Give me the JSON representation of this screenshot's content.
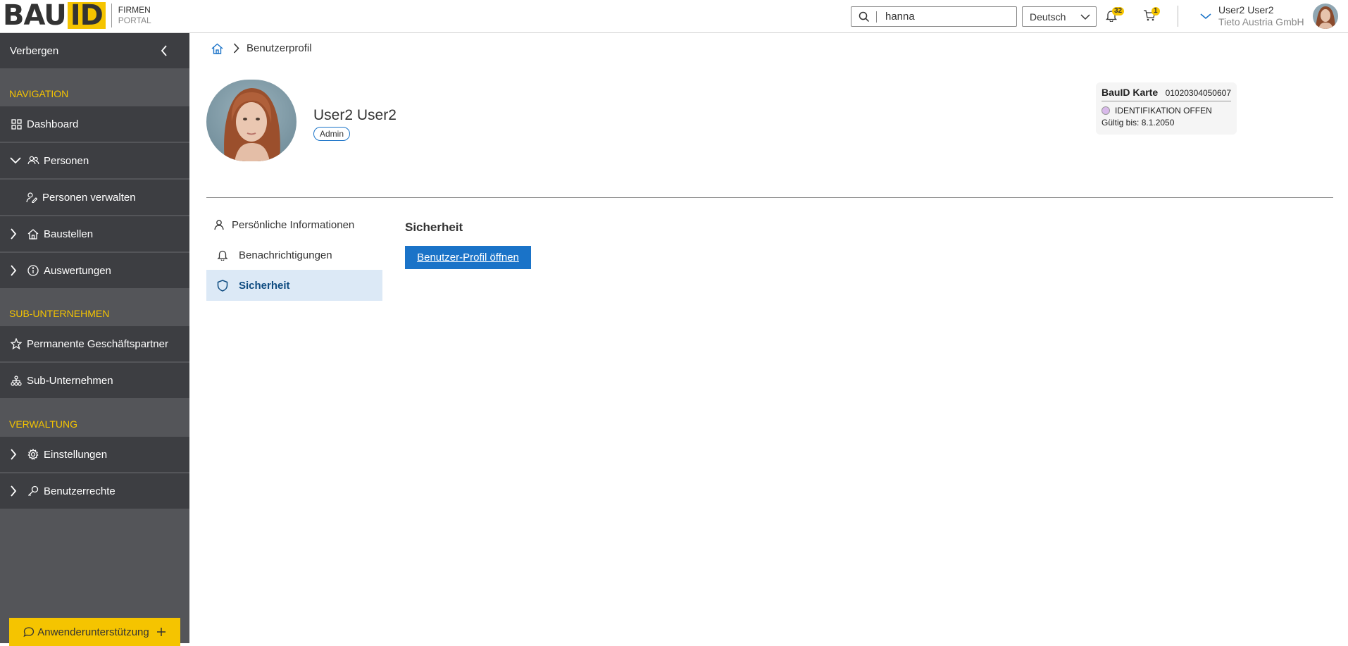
{
  "header": {
    "logo": {
      "mark_left": "BAU",
      "mark_right": "ID",
      "line1": "FIRMEN",
      "line2": "PORTAL"
    },
    "search": {
      "value": "hanna",
      "placeholder": ""
    },
    "language": {
      "selected": "Deutsch"
    },
    "notifications": {
      "count": "32"
    },
    "cart": {
      "count": "1"
    },
    "user": {
      "name": "User2 User2",
      "company": "Tieto Austria GmbH"
    }
  },
  "sidebar": {
    "hide_label": "Verbergen",
    "sections": [
      {
        "heading": "NAVIGATION"
      },
      {
        "heading": "SUB-UNTERNEHMEN"
      },
      {
        "heading": "VERWALTUNG"
      }
    ],
    "items": [
      {
        "label": "Dashboard",
        "icon": "grid-icon"
      },
      {
        "label": "Personen",
        "icon": "people-icon",
        "expanded": true
      },
      {
        "label": "Personen verwalten",
        "icon": "person-edit-icon"
      },
      {
        "label": "Baustellen",
        "icon": "home-icon"
      },
      {
        "label": "Auswertungen",
        "icon": "info-icon"
      },
      {
        "label": "Permanente Geschäftspartner",
        "icon": "star-icon"
      },
      {
        "label": "Sub-Unternehmen",
        "icon": "org-chart-icon"
      },
      {
        "label": "Einstellungen",
        "icon": "gear-icon"
      },
      {
        "label": "Benutzerrechte",
        "icon": "key-icon"
      }
    ],
    "support_label": "Anwenderunterstützung"
  },
  "breadcrumb": {
    "current": "Benutzerprofil"
  },
  "profile": {
    "name": "User2 User2",
    "role": "Admin"
  },
  "card": {
    "title": "BauID Karte",
    "number": "01020304050607",
    "status": "IDENTIFIKATION OFFEN",
    "valid": "Gültig bis: 8.1.2050"
  },
  "tabs": [
    {
      "label": "Persönliche Informationen",
      "icon": "person-icon"
    },
    {
      "label": "Benachrichtigungen",
      "icon": "bell-icon"
    },
    {
      "label": "Sicherheit",
      "icon": "shield-icon",
      "active": true
    }
  ],
  "content": {
    "section_title": "Sicherheit",
    "button_label": "Benutzer-Profil öffnen"
  },
  "colors": {
    "sidebar_bg": "#545559",
    "sidebar_item_bg": "#3d3e42",
    "accent_yellow": "#f5c400",
    "primary_blue": "#1a73c8",
    "active_tab_bg": "#dce9f6"
  }
}
